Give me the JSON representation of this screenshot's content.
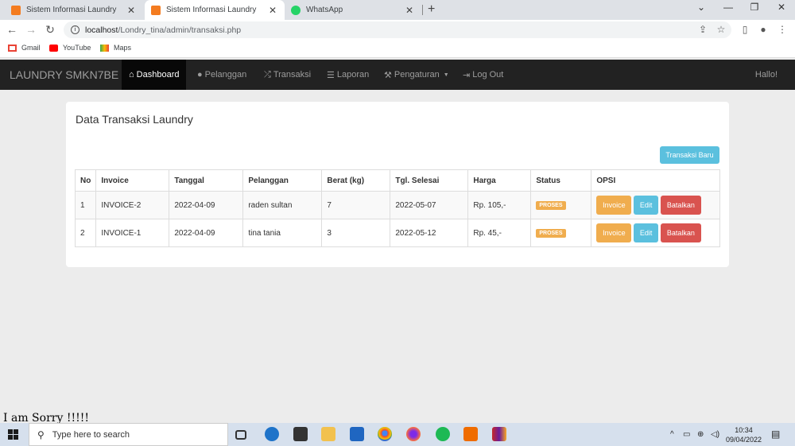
{
  "browser": {
    "tabs": [
      {
        "title": "Sistem Informasi Laundry",
        "favicon": "xampp-icon",
        "active": false
      },
      {
        "title": "Sistem Informasi Laundry",
        "favicon": "xampp-icon",
        "active": true
      },
      {
        "title": "WhatsApp",
        "favicon": "whatsapp-icon",
        "active": false
      }
    ],
    "url_host": "localhost",
    "url_path": "/Londry_tina/admin/transaksi.php",
    "bookmarks": [
      {
        "label": "Gmail",
        "icon": "gmail-icon"
      },
      {
        "label": "YouTube",
        "icon": "youtube-icon"
      },
      {
        "label": "Maps",
        "icon": "maps-icon"
      }
    ]
  },
  "navbar": {
    "brand": "LAUNDRY SMKN7BE",
    "items": [
      {
        "label": "Dashboard",
        "icon": "home-icon"
      },
      {
        "label": "Pelanggan",
        "icon": "user-icon"
      },
      {
        "label": "Transaksi",
        "icon": "random-icon"
      },
      {
        "label": "Laporan",
        "icon": "list-icon"
      },
      {
        "label": "Pengaturan",
        "icon": "wrench-icon"
      },
      {
        "label": "Log Out",
        "icon": "logout-icon"
      }
    ],
    "greeting": "Hallo!"
  },
  "panel": {
    "title": "Data Transaksi Laundry",
    "new_button": "Transaksi Baru"
  },
  "table": {
    "headers": [
      "No",
      "Invoice",
      "Tanggal",
      "Pelanggan",
      "Berat (kg)",
      "Tgl. Selesai",
      "Harga",
      "Status",
      "OPSI"
    ],
    "rows": [
      {
        "no": "1",
        "invoice": "INVOICE-2",
        "tanggal": "2022-04-09",
        "pelanggan": "raden sultan",
        "berat": "7",
        "selesai": "2022-05-07",
        "harga": "Rp. 105,-",
        "status": "PROSES"
      },
      {
        "no": "2",
        "invoice": "INVOICE-1",
        "tanggal": "2022-04-09",
        "pelanggan": "tina tania",
        "berat": "3",
        "selesai": "2022-05-12",
        "harga": "Rp. 45,-",
        "status": "PROSES"
      }
    ],
    "actions": {
      "invoice": "Invoice",
      "edit": "Edit",
      "batal": "Batalkan"
    }
  },
  "overlay_text": "I am Sorry !!!!!",
  "taskbar": {
    "search_placeholder": "Type here to search",
    "time": "10:34",
    "date": "09/04/2022"
  },
  "colors": {
    "navbar": "#222222",
    "primary_info": "#5bc0de",
    "warning": "#f0ad4e",
    "danger": "#d9534f"
  }
}
